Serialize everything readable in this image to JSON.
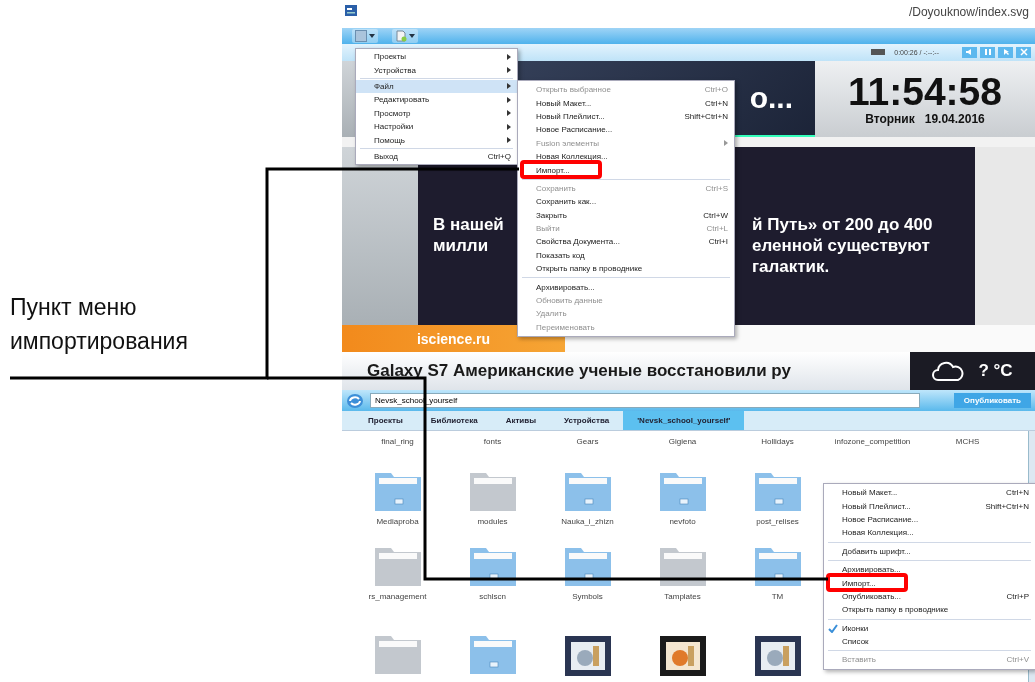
{
  "annotation": {
    "text": "Пункт меню импортирования"
  },
  "window": {
    "path": "/Doyouknow/index.svg"
  },
  "player": {
    "time": "0:00:26 / -:--:--"
  },
  "headline": {
    "text": "о..."
  },
  "clock": {
    "time": "11:54:58",
    "weekday": "Вторник",
    "date": "19.04.2016"
  },
  "news": {
    "lines": [
      {
        "left": "В нашей",
        "right": "й Путь» от 200 до 400"
      },
      {
        "left": "милли",
        "right": "еленной существуют"
      },
      {
        "right": "галактик."
      }
    ]
  },
  "source_label": "iscience.ru",
  "ticker": {
    "text": "Galaxy S7   Американские ученые восстановили ру"
  },
  "weather": {
    "temperature": "? °C"
  },
  "path_bar": {
    "value": "Nevsk_school_yourself",
    "button": "Опубликовать"
  },
  "tabs": [
    {
      "label": "Проекты",
      "selected": false
    },
    {
      "label": "Библиотека",
      "selected": false
    },
    {
      "label": "Активы",
      "selected": false
    },
    {
      "label": "Устройства",
      "selected": false
    },
    {
      "label": "'Nevsk_school_yourself'",
      "selected": true
    }
  ],
  "files": [
    [
      {
        "kind": "caption",
        "name": "final_ring"
      },
      {
        "kind": "caption",
        "name": "fonts"
      },
      {
        "kind": "caption",
        "name": "Gears"
      },
      {
        "kind": "caption",
        "name": "Gigiena"
      },
      {
        "kind": "caption",
        "name": "Hollidays"
      },
      {
        "kind": "caption",
        "name": "infozone_competition"
      },
      {
        "kind": "caption",
        "name": "MCHS"
      }
    ],
    [
      {
        "kind": "folder",
        "color": "#8cc0ea",
        "name": "Mediaproba"
      },
      {
        "kind": "folder",
        "color": "#c3c8ce",
        "name": "modules"
      },
      {
        "kind": "folder",
        "color": "#8cc0ea",
        "name": "Nauka_i_zhizn"
      },
      {
        "kind": "folder",
        "color": "#8cc0ea",
        "name": "nevfoto"
      },
      {
        "kind": "folder",
        "color": "#8cc0ea",
        "name": "post_relises"
      }
    ],
    [
      {
        "kind": "folder",
        "color": "#c3c8ce",
        "name": "rs_management"
      },
      {
        "kind": "folder",
        "color": "#8cc0ea",
        "name": "schlscn"
      },
      {
        "kind": "folder",
        "color": "#8cc0ea",
        "name": "Symbols"
      },
      {
        "kind": "folder",
        "color": "#c3c8ce",
        "name": "Tamplates"
      },
      {
        "kind": "folder",
        "color": "#8cc0ea",
        "name": "TM"
      }
    ],
    [
      {
        "kind": "folder",
        "color": "#c3c8ce"
      },
      {
        "kind": "folder",
        "color": "#8cc0ea"
      },
      {
        "kind": "picture"
      },
      {
        "kind": "picture"
      },
      {
        "kind": "picture"
      }
    ]
  ],
  "main_menu": {
    "items": [
      {
        "kind": "item",
        "label": "Проекты",
        "submenu": true,
        "selected": false
      },
      {
        "kind": "item",
        "label": "Устройства",
        "submenu": true,
        "selected": false
      },
      {
        "kind": "separator"
      },
      {
        "kind": "item",
        "label": "Файл",
        "submenu": true,
        "selected": true
      },
      {
        "kind": "item",
        "label": "Редактировать",
        "submenu": true,
        "selected": false
      },
      {
        "kind": "item",
        "label": "Просмотр",
        "submenu": true,
        "selected": false
      },
      {
        "kind": "item",
        "label": "Настройки",
        "submenu": true,
        "selected": false
      },
      {
        "kind": "item",
        "label": "Помощь",
        "submenu": true,
        "selected": false
      },
      {
        "kind": "separator"
      },
      {
        "kind": "item",
        "label": "Выход",
        "shortcut": "Ctrl+Q",
        "submenu": false,
        "selected": false
      }
    ]
  },
  "file_menu": {
    "items": [
      {
        "kind": "item",
        "label": "Открыть выбранное",
        "shortcut": "Ctrl+O",
        "disabled": true,
        "marked": false
      },
      {
        "kind": "item",
        "label": "Новый Макет...",
        "shortcut": "Ctrl+N",
        "disabled": false,
        "marked": false
      },
      {
        "kind": "item",
        "label": "Новый Плейлист...",
        "shortcut": "Shift+Ctrl+N",
        "disabled": false,
        "marked": false
      },
      {
        "kind": "item",
        "label": "Новое Расписание...",
        "disabled": false,
        "marked": false
      },
      {
        "kind": "item",
        "label": "Fusion элементы",
        "submenu": true,
        "disabled": true,
        "marked": false
      },
      {
        "kind": "item",
        "label": "Новая Коллекция...",
        "disabled": false,
        "marked": false
      },
      {
        "kind": "item",
        "label": "Импорт...",
        "disabled": false,
        "marked": true
      },
      {
        "kind": "separator"
      },
      {
        "kind": "item",
        "label": "Сохранить",
        "shortcut": "Ctrl+S",
        "disabled": true,
        "marked": false
      },
      {
        "kind": "item",
        "label": "Сохранить как...",
        "disabled": false,
        "marked": false
      },
      {
        "kind": "item",
        "label": "Закрыть",
        "shortcut": "Ctrl+W",
        "disabled": false,
        "marked": false
      },
      {
        "kind": "item",
        "label": "Выйти",
        "shortcut": "Ctrl+L",
        "disabled": true,
        "marked": false
      },
      {
        "kind": "item",
        "label": "Свойства Документа...",
        "shortcut": "Ctrl+I",
        "disabled": false,
        "marked": false
      },
      {
        "kind": "item",
        "label": "Показать код",
        "disabled": false,
        "marked": false
      },
      {
        "kind": "item",
        "label": "Открыть папку в проводнике",
        "disabled": false,
        "marked": false
      },
      {
        "kind": "separator"
      },
      {
        "kind": "item",
        "label": "Архивировать...",
        "disabled": false,
        "marked": false
      },
      {
        "kind": "item",
        "label": "Обновить данные",
        "disabled": true,
        "marked": false
      },
      {
        "kind": "item",
        "label": "Удалить",
        "disabled": true,
        "marked": false
      },
      {
        "kind": "item",
        "label": "Переименовать",
        "disabled": true,
        "marked": false
      }
    ]
  },
  "context_menu": {
    "items": [
      {
        "kind": "item",
        "label": "Новый Макет...",
        "shortcut": "Ctrl+N",
        "disabled": false,
        "marked": false
      },
      {
        "kind": "item",
        "label": "Новый Плейлист...",
        "shortcut": "Shift+Ctrl+N",
        "disabled": false,
        "marked": false
      },
      {
        "kind": "item",
        "label": "Новое Расписание...",
        "disabled": false,
        "marked": false
      },
      {
        "kind": "item",
        "label": "Новая Коллекция...",
        "disabled": false,
        "marked": false
      },
      {
        "kind": "separator"
      },
      {
        "kind": "item",
        "label": "Добавить шрифт...",
        "disabled": false,
        "marked": false
      },
      {
        "kind": "separator"
      },
      {
        "kind": "item",
        "label": "Архивировать...",
        "disabled": false,
        "marked": false
      },
      {
        "kind": "item",
        "label": "Импорт...",
        "disabled": false,
        "marked": true
      },
      {
        "kind": "item",
        "label": "Опубликовать...",
        "shortcut": "Ctrl+P",
        "disabled": false,
        "marked": false
      },
      {
        "kind": "item",
        "label": "Открыть папку в проводнике",
        "disabled": false,
        "marked": false
      },
      {
        "kind": "separator"
      },
      {
        "kind": "check",
        "label": "Иконки",
        "checked": true,
        "disabled": false,
        "marked": false
      },
      {
        "kind": "check",
        "label": "Список",
        "checked": false,
        "disabled": false,
        "marked": false
      },
      {
        "kind": "separator"
      },
      {
        "kind": "item",
        "label": "Вставить",
        "shortcut": "Ctrl+V",
        "disabled": true,
        "marked": false
      }
    ]
  }
}
